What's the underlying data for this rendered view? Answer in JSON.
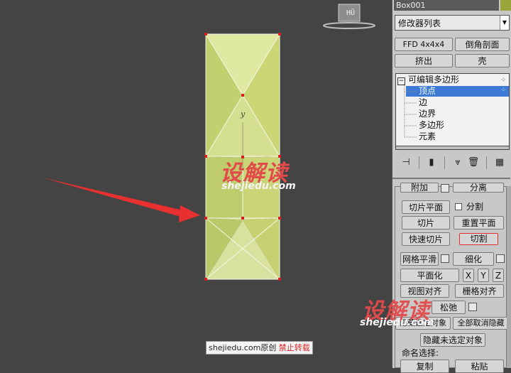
{
  "viewport": {
    "cube_label": "HÜ",
    "axis_label": "y"
  },
  "watermarks": {
    "center_big": "设解读",
    "center_small": "shejiedu.com",
    "panel_big": "设解读",
    "panel_small": "shejiedu.com"
  },
  "credit": {
    "site": "shejiedu.com原创",
    "warning": "禁止转载"
  },
  "panel": {
    "object_name": "Box001",
    "object_color": "#9aa63a",
    "modifier_list": "修改器列表",
    "buttons": {
      "ffd": "FFD 4x4x4",
      "bevel_profile": "倒角剖面",
      "extrude": "挤出",
      "shell": "壳"
    },
    "stack": {
      "root": "可编辑多边形",
      "items": [
        "顶点",
        "边",
        "边界",
        "多边形",
        "元素"
      ],
      "selected": "顶点"
    },
    "edit_geometry": {
      "attach": "附加",
      "detach": "分离",
      "slice_plane": "切片平面",
      "split": "分割",
      "slice": "切片",
      "reset_plane": "重置平面",
      "quickslice": "快速切片",
      "cut": "切割",
      "meshsmooth": "网格平滑",
      "tessellate": "细化",
      "planarize": "平面化",
      "x": "X",
      "y": "Y",
      "z": "Z",
      "view_align": "视图对齐",
      "grid_align": "栅格对齐",
      "relax": "松弛",
      "hide_selected": "隐藏选定对象",
      "unhide_all": "全部取消隐藏",
      "hide_unselected": "隐藏未选定对象",
      "named_selections": "命名选择:",
      "copy": "复制",
      "paste": "粘贴"
    }
  }
}
